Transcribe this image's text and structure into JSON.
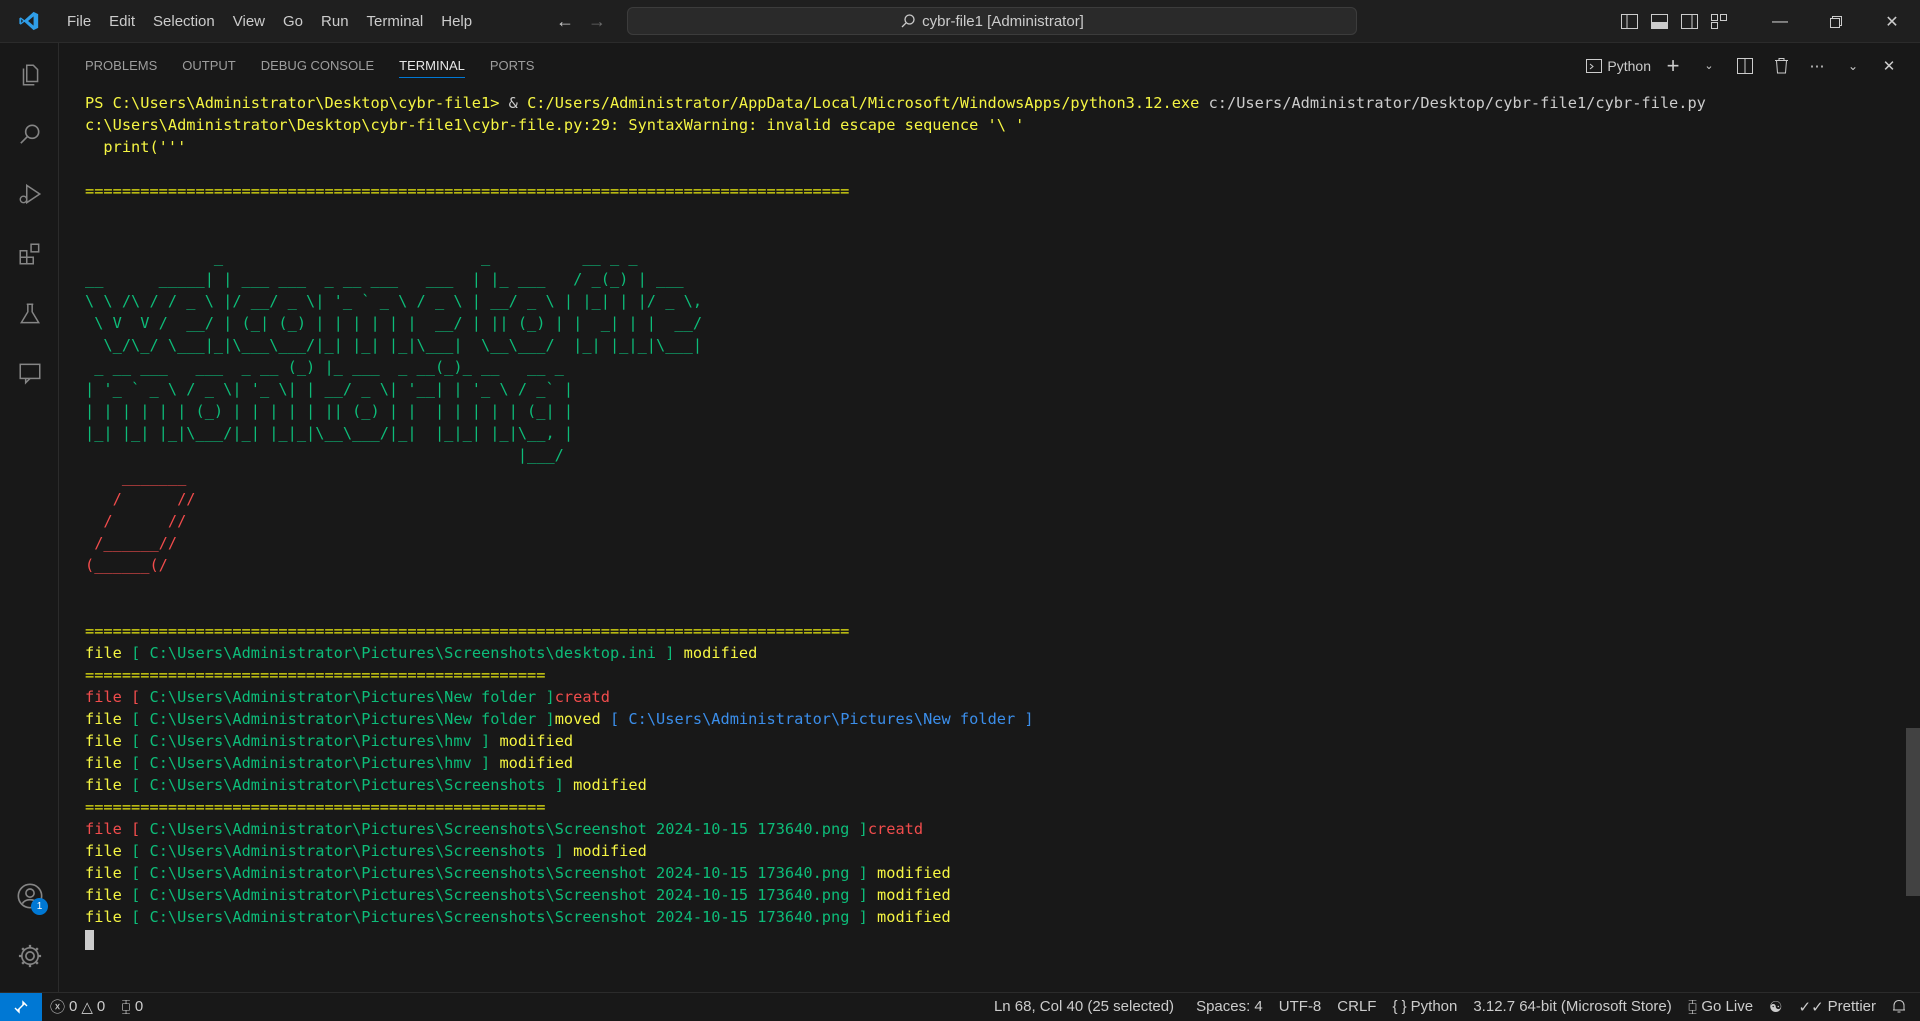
{
  "window": {
    "title": "cybr-file1 [Administrator]",
    "menu": [
      "File",
      "Edit",
      "Selection",
      "View",
      "Go",
      "Run",
      "Terminal",
      "Help"
    ]
  },
  "panel": {
    "tabs": [
      "PROBLEMS",
      "OUTPUT",
      "DEBUG CONSOLE",
      "TERMINAL",
      "PORTS"
    ],
    "active_tab": "TERMINAL",
    "terminal_profile": "Python"
  },
  "activity": {
    "accounts_badge": "1"
  },
  "terminal_lines": [
    [
      {
        "t": "PS C:\\Users\\Administrator\\Desktop\\cybr-file1> ",
        "c": "c-bold-yellow"
      },
      {
        "t": "& ",
        "c": "c-white"
      },
      {
        "t": "C:/Users/Administrator/AppData/Local/Microsoft/WindowsApps/python3.12.exe",
        "c": "c-bold-yellow"
      },
      {
        "t": " c:/Users/Administrator/Desktop/cybr-file1/cybr-file.py",
        "c": "c-white"
      }
    ],
    [
      {
        "t": "c:\\Users\\Administrator\\Desktop\\cybr-file1\\cybr-file.py:29: SyntaxWarning: invalid escape sequence '\\ '",
        "c": "c-bold-yellow"
      }
    ],
    [
      {
        "t": "  print('''",
        "c": "c-bold-yellow"
      }
    ],
    [
      {
        "t": "",
        "c": "c-white"
      }
    ],
    [
      {
        "t": "===================================================================================",
        "c": "c-yellow"
      }
    ],
    [
      {
        "t": "",
        "c": "c-white"
      }
    ],
    [
      {
        "t": "",
        "c": "c-white"
      }
    ],
    [
      {
        "t": "              _                            _          __ _ _",
        "c": "c-green"
      }
    ],
    [
      {
        "t": "__      _____| | ___ ___  _ __ ___   ___  | |_ ___   / _(_) | ___",
        "c": "c-green"
      }
    ],
    [
      {
        "t": "\\ \\ /\\ / / _ \\ |/ __/ _ \\| '_ ` _ \\ / _ \\ | __/ _ \\ | |_| | |/ _ \\,",
        "c": "c-green"
      }
    ],
    [
      {
        "t": " \\ V  V /  __/ | (_| (_) | | | | | |  __/ | || (_) | |  _| | |  __/",
        "c": "c-green"
      }
    ],
    [
      {
        "t": "  \\_/\\_/ \\___|_|\\___\\___/|_| |_| |_|\\___|  \\__\\___/  |_| |_|_|\\___|",
        "c": "c-green"
      }
    ],
    [
      {
        "t": " _ __ ___   ___  _ __ (_) |_ ___  _ __(_)_ __   __ _",
        "c": "c-green"
      }
    ],
    [
      {
        "t": "| '_ ` _ \\ / _ \\| '_ \\| | __/ _ \\| '__| | '_ \\ / _` |",
        "c": "c-green"
      }
    ],
    [
      {
        "t": "| | | | | | (_) | | | | | || (_) | |  | | | | | (_| |",
        "c": "c-green"
      }
    ],
    [
      {
        "t": "|_| |_| |_|\\___/|_| |_|_|\\__\\___/|_|  |_|_| |_|\\__, |",
        "c": "c-green"
      }
    ],
    [
      {
        "t": "                                               |___/",
        "c": "c-green"
      }
    ],
    [
      {
        "t": "    _______",
        "c": "c-red"
      }
    ],
    [
      {
        "t": "   /      //",
        "c": "c-red"
      }
    ],
    [
      {
        "t": "  /      //",
        "c": "c-red"
      }
    ],
    [
      {
        "t": " /______//",
        "c": "c-red"
      }
    ],
    [
      {
        "t": "(______(/",
        "c": "c-red"
      }
    ],
    [
      {
        "t": "",
        "c": "c-white"
      }
    ],
    [
      {
        "t": "",
        "c": "c-white"
      }
    ],
    [
      {
        "t": "===================================================================================",
        "c": "c-yellow"
      }
    ],
    [
      {
        "t": "file ",
        "c": "c-bold-yellow"
      },
      {
        "t": "[ C:\\Users\\Administrator\\Pictures\\Screenshots\\desktop.ini ]",
        "c": "c-green"
      },
      {
        "t": " modified",
        "c": "c-bold-yellow"
      }
    ],
    [
      {
        "t": "==================================================",
        "c": "c-yellow"
      }
    ],
    [
      {
        "t": "file [ ",
        "c": "c-red"
      },
      {
        "t": "C:\\Users\\Administrator\\Pictures\\New folder ]",
        "c": "c-green"
      },
      {
        "t": "creatd",
        "c": "c-red"
      }
    ],
    [
      {
        "t": "file ",
        "c": "c-bold-yellow"
      },
      {
        "t": "[ C:\\Users\\Administrator\\Pictures\\New folder ]",
        "c": "c-green"
      },
      {
        "t": "moved",
        "c": "c-bold-yellow"
      },
      {
        "t": " [ C:\\Users\\Administrator\\Pictures\\New folder ]",
        "c": "c-blue"
      }
    ],
    [
      {
        "t": "file ",
        "c": "c-bold-yellow"
      },
      {
        "t": "[ C:\\Users\\Administrator\\Pictures\\hmv ]",
        "c": "c-green"
      },
      {
        "t": " modified",
        "c": "c-bold-yellow"
      }
    ],
    [
      {
        "t": "file ",
        "c": "c-bold-yellow"
      },
      {
        "t": "[ C:\\Users\\Administrator\\Pictures\\hmv ]",
        "c": "c-green"
      },
      {
        "t": " modified",
        "c": "c-bold-yellow"
      }
    ],
    [
      {
        "t": "file ",
        "c": "c-bold-yellow"
      },
      {
        "t": "[ C:\\Users\\Administrator\\Pictures\\Screenshots ]",
        "c": "c-green"
      },
      {
        "t": " modified",
        "c": "c-bold-yellow"
      }
    ],
    [
      {
        "t": "==================================================",
        "c": "c-yellow"
      }
    ],
    [
      {
        "t": "file [ ",
        "c": "c-red"
      },
      {
        "t": "C:\\Users\\Administrator\\Pictures\\Screenshots\\Screenshot 2024-10-15 173640.png ]",
        "c": "c-green"
      },
      {
        "t": "creatd",
        "c": "c-red"
      }
    ],
    [
      {
        "t": "file ",
        "c": "c-bold-yellow"
      },
      {
        "t": "[ C:\\Users\\Administrator\\Pictures\\Screenshots ]",
        "c": "c-green"
      },
      {
        "t": " modified",
        "c": "c-bold-yellow"
      }
    ],
    [
      {
        "t": "file ",
        "c": "c-bold-yellow"
      },
      {
        "t": "[ C:\\Users\\Administrator\\Pictures\\Screenshots\\Screenshot 2024-10-15 173640.png ]",
        "c": "c-green"
      },
      {
        "t": " modified",
        "c": "c-bold-yellow"
      }
    ],
    [
      {
        "t": "file ",
        "c": "c-bold-yellow"
      },
      {
        "t": "[ C:\\Users\\Administrator\\Pictures\\Screenshots\\Screenshot 2024-10-15 173640.png ]",
        "c": "c-green"
      },
      {
        "t": " modified",
        "c": "c-bold-yellow"
      }
    ],
    [
      {
        "t": "file ",
        "c": "c-bold-yellow"
      },
      {
        "t": "[ C:\\Users\\Administrator\\Pictures\\Screenshots\\Screenshot 2024-10-15 173640.png ]",
        "c": "c-green"
      },
      {
        "t": " modified",
        "c": "c-bold-yellow"
      }
    ]
  ],
  "statusbar": {
    "errors": "0",
    "warnings": "0",
    "ports": "0",
    "cursor_position": "Ln 68, Col 40 (25 selected)",
    "indentation": "Spaces: 4",
    "encoding": "UTF-8",
    "eol": "CRLF",
    "language": "Python",
    "interpreter": "3.12.7 64-bit (Microsoft Store)",
    "go_live": "Go Live",
    "prettier": "Prettier"
  },
  "colors": {
    "accent": "#0078d4",
    "background": "#181818",
    "ansi_green": "#0dbc79",
    "ansi_yellow": "#e5e510",
    "ansi_red": "#f14c4c",
    "ansi_blue": "#3b8eea"
  }
}
